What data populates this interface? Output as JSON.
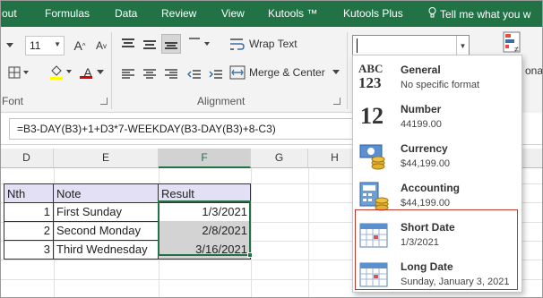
{
  "ribbon_tabs": [
    "out",
    "Formulas",
    "Data",
    "Review",
    "View",
    "Kutools ™",
    "Kutools Plus"
  ],
  "tell_me": "Tell me what you w",
  "font": {
    "size": "11",
    "grow": "A",
    "shrink": "A",
    "font_color_letter": "A"
  },
  "groups": {
    "font_label": "Font",
    "alignment_label": "Alignment"
  },
  "alignment": {
    "wrap_text": "Wrap Text",
    "merge_center": "Merge & Center"
  },
  "right_group_partial": "ona",
  "formula": "=B3-DAY(B3)+1+D3*7-WEEKDAY(B3-DAY(B3)+8-C3)",
  "columns": [
    "D",
    "E",
    "F",
    "G",
    "H"
  ],
  "table": {
    "headers": [
      "Nth",
      "Note",
      "Result"
    ],
    "rows": [
      {
        "nth": "1",
        "note": "First Sunday",
        "result": "1/3/2021"
      },
      {
        "nth": "2",
        "note": "Second Monday",
        "result": "2/8/2021"
      },
      {
        "nth": "3",
        "note": "Third Wednesday",
        "result": "3/16/2021"
      }
    ]
  },
  "number_formats": [
    {
      "title": "General",
      "sub": "No specific format",
      "icon": "abc-123-icon"
    },
    {
      "title": "Number",
      "sub": "44199.00",
      "icon": "number-12-icon"
    },
    {
      "title": "Currency",
      "sub": "$44,199.00",
      "icon": "currency-icon"
    },
    {
      "title": "Accounting",
      "sub": "$44,199.00",
      "icon": "accounting-icon"
    },
    {
      "title": "Short Date",
      "sub": "1/3/2021",
      "icon": "calendar-icon"
    },
    {
      "title": "Long Date",
      "sub": "Sunday, January 3, 2021",
      "icon": "calendar-icon"
    }
  ],
  "icon_glyphs": {
    "abc": "ABC",
    "n123": "123",
    "n12": "12"
  },
  "colors": {
    "excel_green": "#217346",
    "font_red": "#e00000",
    "header_fill": "#e3e0f6",
    "highlight_red": "#c0392b"
  }
}
